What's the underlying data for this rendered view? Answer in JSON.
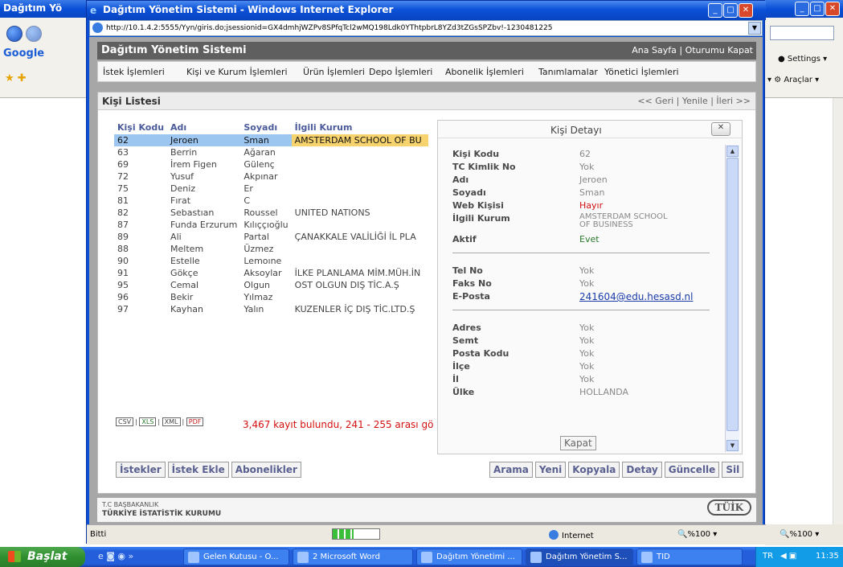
{
  "background_window": {
    "title": "Dağıtım Yö",
    "google_label": "Google",
    "settings_label": "Settings",
    "tools_label": "Araçlar",
    "zoom": "%100"
  },
  "popup": {
    "title": "Dağıtım Yönetim Sistemi - Windows Internet Explorer",
    "address": "http://10.1.4.2:5555/Yyn/giris.do;jsessionid=GX4dmhjWZPv8SPfqTcl2wMQ198Ldk0YThtpbrL8YZd3tZGsSPZbv!-1230481225",
    "status_text": "Bitti",
    "progress_fraction": 0.45,
    "zone": "Internet",
    "zoom": "%100"
  },
  "app": {
    "name": "Dağıtım Yönetim Sistemi",
    "home_link": "Ana Sayfa",
    "logout_link": "Oturumu Kapat",
    "link_separator": "|",
    "menu": [
      "İstek İşlemleri",
      "Kişi ve Kurum İşlemleri",
      "Ürün İşlemleri",
      "Depo İşlemleri",
      "Abonelik İşlemleri",
      "Tanımlamalar",
      "Yönetici İşlemleri"
    ]
  },
  "list": {
    "title": "Kişi Listesi",
    "nav": "<< Geri | Yenile | İleri >>",
    "columns": [
      "Kişi Kodu",
      "Adı",
      "Soyadı",
      "İlgili Kurum"
    ],
    "rows": [
      {
        "code": "62",
        "name": "Jeroen",
        "surname": "Sman",
        "org": "AMSTERDAM SCHOOL OF BU"
      },
      {
        "code": "63",
        "name": "Berrin",
        "surname": "Ağaran",
        "org": ""
      },
      {
        "code": "69",
        "name": "İrem Figen",
        "surname": "Gülenç",
        "org": ""
      },
      {
        "code": "72",
        "name": "Yusuf",
        "surname": "Akpınar",
        "org": ""
      },
      {
        "code": "75",
        "name": "Deniz",
        "surname": "Er",
        "org": ""
      },
      {
        "code": "81",
        "name": "Fırat",
        "surname": "C",
        "org": ""
      },
      {
        "code": "82",
        "name": "Sebastıan",
        "surname": "Roussel",
        "org": "UNITED NATIONS"
      },
      {
        "code": "87",
        "name": "Funda Erzurum",
        "surname": "Kılıççıoğlu",
        "org": ""
      },
      {
        "code": "89",
        "name": "Ali",
        "surname": "Partal",
        "org": "ÇANAKKALE VALİLİĞİ İL PLA"
      },
      {
        "code": "88",
        "name": "Meltem",
        "surname": "Üzmez",
        "org": ""
      },
      {
        "code": "90",
        "name": "Estelle",
        "surname": "Lemoıne",
        "org": ""
      },
      {
        "code": "91",
        "name": "Gökçe",
        "surname": "Aksoylar",
        "org": "İLKE PLANLAMA MİM.MÜH.İN"
      },
      {
        "code": "95",
        "name": "Cemal",
        "surname": "Olgun",
        "org": "OST OLGUN DIŞ TİC.A.Ş"
      },
      {
        "code": "96",
        "name": "Bekir",
        "surname": "Yılmaz",
        "org": ""
      },
      {
        "code": "97",
        "name": "Kayhan",
        "surname": "Yalın",
        "org": "KUZENLER İÇ DIŞ TİC.LTD.Ş"
      }
    ],
    "export": [
      "CSV",
      "XLS",
      "XML",
      "PDF"
    ],
    "record_count": "3,467 kayıt bulundu, 241 - 255 arası gö",
    "left_buttons": [
      "İstekler",
      "İstek Ekle",
      "Abonelikler"
    ],
    "right_buttons": [
      "Arama",
      "Yeni",
      "Kopyala",
      "Detay",
      "Güncelle",
      "Sil"
    ]
  },
  "footer": {
    "org1": "T.C BAŞBAKANLIK",
    "org2": "TÜRKİYE İSTATİSTİK KURUMU",
    "logo": "TÜİK"
  },
  "detail": {
    "title": "Kişi Detayı",
    "close_label": "Kapat",
    "kisi_kodu_label": "Kişi Kodu",
    "kisi_kodu": "62",
    "tc_label": "TC Kimlik No",
    "tc": "Yok",
    "adi_label": "Adı",
    "adi": "Jeroen",
    "soyadi_label": "Soyadı",
    "soyadi": "Sman",
    "web_label": "Web Kişisi",
    "web": "Hayır",
    "kurum_label": "İlgili Kurum",
    "kurum1": "AMSTERDAM SCHOOL",
    "kurum2": "OF BUSINESS",
    "aktif_label": "Aktif",
    "aktif": "Evet",
    "tel_label": "Tel No",
    "tel": "Yok",
    "faks_label": "Faks No",
    "faks": "Yok",
    "eposta_label": "E-Posta",
    "eposta": "241604@edu.hesasd.nl",
    "adres_label": "Adres",
    "adres": "Yok",
    "semt_label": "Semt",
    "semt": "Yok",
    "posta_label": "Posta Kodu",
    "posta": "Yok",
    "ilce_label": "İlçe",
    "ilce": "Yok",
    "il_label": "İl",
    "il": "Yok",
    "ulke_label": "Ülke",
    "ulke": "HOLLANDA"
  },
  "taskbar": {
    "start": "Başlat",
    "tasks": [
      "Gelen Kutusu - O...",
      "2 Microsoft Word",
      "Dağıtım Yönetimi ...",
      "Dağıtım Yönetim S...",
      "TID"
    ],
    "lang": "TR",
    "clock": "11:35"
  }
}
